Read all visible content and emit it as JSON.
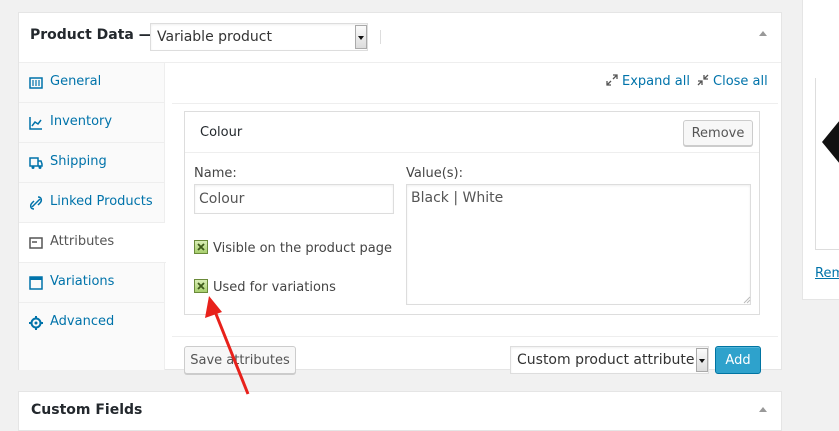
{
  "product_data": {
    "title": "Product Data —",
    "type_select": "Variable product",
    "tabs": [
      {
        "label": "General",
        "icon": "general-icon"
      },
      {
        "label": "Inventory",
        "icon": "inventory-icon"
      },
      {
        "label": "Shipping",
        "icon": "shipping-icon"
      },
      {
        "label": "Linked Products",
        "icon": "link-icon"
      },
      {
        "label": "Attributes",
        "icon": "attributes-icon",
        "active": true
      },
      {
        "label": "Variations",
        "icon": "variations-icon"
      },
      {
        "label": "Advanced",
        "icon": "gear-icon"
      }
    ],
    "toolbar": {
      "expand_all": "Expand all",
      "close_all": "Close all"
    },
    "attribute": {
      "title": "Colour",
      "remove_label": "Remove",
      "name_label": "Name:",
      "name_value": "Colour",
      "values_label": "Value(s):",
      "values_value": "Black | White",
      "visible_label": "Visible on the product page",
      "visible_checked": true,
      "variations_label": "Used for variations",
      "variations_checked": true
    },
    "footer": {
      "save_label": "Save attributes",
      "attribute_select": "Custom product attribute",
      "add_label": "Add"
    }
  },
  "custom_fields": {
    "title": "Custom Fields"
  },
  "sidebar": {
    "link_text": "Rem"
  },
  "colors": {
    "link": "#0073aa",
    "add_button": "#2ea2cc",
    "checkbox": "#a8cf6e",
    "annotation_arrow": "#e8211b"
  }
}
